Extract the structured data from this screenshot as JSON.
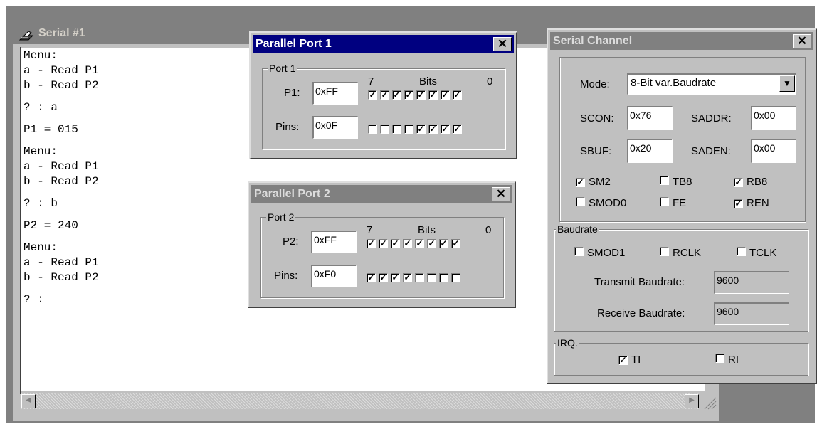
{
  "serial_window": {
    "title": "Serial #1",
    "console_lines": [
      "Menu:",
      "a - Read P1",
      "b - Read P2",
      "",
      "? : a",
      "",
      "P1 = 015",
      "",
      "Menu:",
      "a - Read P1",
      "b - Read P2",
      "",
      "? : b",
      "",
      "P2 = 240",
      "",
      "Menu:",
      "a - Read P1",
      "b - Read P2",
      "",
      "? :"
    ]
  },
  "parallel_port_1": {
    "title": "Parallel Port 1",
    "close": "✕",
    "group_label": "Port 1",
    "bits_high": "7",
    "bits_label": "Bits",
    "bits_low": "0",
    "port_label": "P1:",
    "port_value": "0xFF",
    "pins_label": "Pins:",
    "pins_value": "0x0F",
    "port_bits": [
      true,
      true,
      true,
      true,
      true,
      true,
      true,
      true
    ],
    "pin_bits": [
      false,
      false,
      false,
      false,
      true,
      true,
      true,
      true
    ]
  },
  "parallel_port_2": {
    "title": "Parallel Port 2",
    "close": "✕",
    "group_label": "Port 2",
    "bits_high": "7",
    "bits_label": "Bits",
    "bits_low": "0",
    "port_label": "P2:",
    "port_value": "0xFF",
    "pins_label": "Pins:",
    "pins_value": "0xF0",
    "port_bits": [
      true,
      true,
      true,
      true,
      true,
      true,
      true,
      true
    ],
    "pin_bits": [
      true,
      true,
      true,
      true,
      false,
      false,
      false,
      false
    ]
  },
  "serial_channel": {
    "title": "Serial Channel",
    "close": "✕",
    "mode_label": "Mode:",
    "mode_value": "8-Bit var.Baudrate",
    "scon_label": "SCON:",
    "scon_value": "0x76",
    "saddr_label": "SADDR:",
    "saddr_value": "0x00",
    "sbuf_label": "SBUF:",
    "sbuf_value": "0x20",
    "saden_label": "SADEN:",
    "saden_value": "0x00",
    "flags": {
      "sm2": {
        "label": "SM2",
        "checked": true
      },
      "tb8": {
        "label": "TB8",
        "checked": false
      },
      "rb8": {
        "label": "RB8",
        "checked": true
      },
      "smod0": {
        "label": "SMOD0",
        "checked": false
      },
      "fe": {
        "label": "FE",
        "checked": false
      },
      "ren": {
        "label": "REN",
        "checked": true
      }
    },
    "baudrate_group": "Baudrate",
    "baud_flags": {
      "smod1": {
        "label": "SMOD1",
        "checked": false
      },
      "rclk": {
        "label": "RCLK",
        "checked": false
      },
      "tclk": {
        "label": "TCLK",
        "checked": false
      }
    },
    "transmit_label": "Transmit Baudrate:",
    "transmit_value": "9600",
    "receive_label": "Receive Baudrate:",
    "receive_value": "9600",
    "irq_group": "IRQ.",
    "irq": {
      "ti": {
        "label": "TI",
        "checked": true
      },
      "ri": {
        "label": "RI",
        "checked": false
      }
    }
  }
}
